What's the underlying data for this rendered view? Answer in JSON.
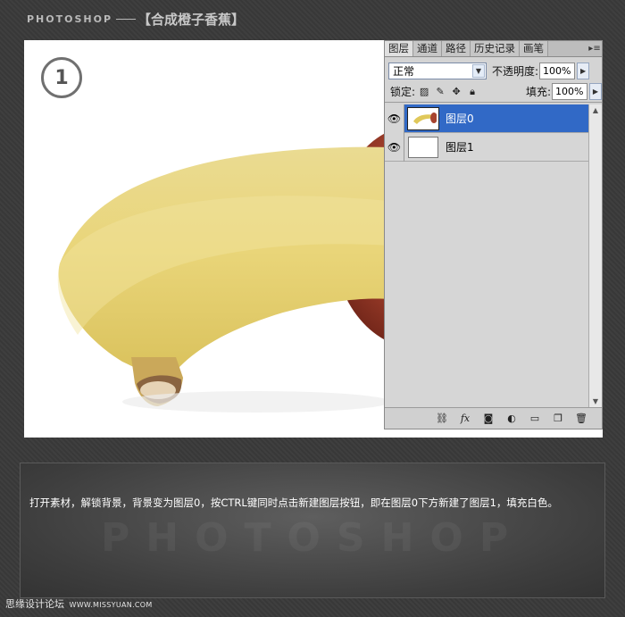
{
  "header": {
    "brand": "PHOTOSHOP",
    "title": "【合成橙子香蕉】"
  },
  "canvas": {
    "step_number": "1"
  },
  "panel": {
    "tabs": [
      {
        "label": "图层",
        "active": true
      },
      {
        "label": "通道",
        "active": false
      },
      {
        "label": "路径",
        "active": false
      },
      {
        "label": "历史记录",
        "active": false
      },
      {
        "label": "画笔",
        "active": false
      }
    ],
    "menu_icon": "panel-menu-icon",
    "blend_mode": "正常",
    "opacity_label": "不透明度:",
    "opacity_value": "100%",
    "lock_label": "锁定:",
    "fill_label": "填充:",
    "fill_value": "100%",
    "layers": [
      {
        "name": "图层0",
        "selected": true,
        "visible": true
      },
      {
        "name": "图层1",
        "selected": false,
        "visible": true
      }
    ],
    "selection_color": "#3169c6"
  },
  "description": {
    "text": "打开素材，解锁背景，背景变为图层0，按CTRL键同时点击新建图层按钮，即在图层0下方新建了图层1，填充白色。",
    "watermark": "PHOTOSHOP"
  },
  "footer": {
    "site_name": "思缘设计论坛",
    "site_url": "WWW.MISSYUAN.COM"
  }
}
